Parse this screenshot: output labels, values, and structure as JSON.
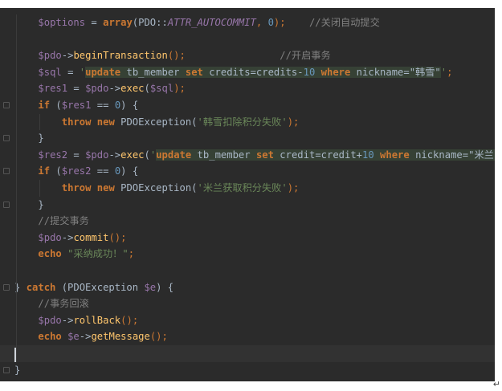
{
  "editor": {
    "lines": [
      [
        {
          "t": "$options",
          "c": "var"
        },
        {
          "t": " = ",
          "c": "cls"
        },
        {
          "t": "array",
          "c": "kw"
        },
        {
          "t": "(PDO::",
          "c": "cls"
        },
        {
          "t": "ATTR_AUTOCOMMIT",
          "c": "const"
        },
        {
          "t": ", ",
          "c": "punc"
        },
        {
          "t": "0",
          "c": "num"
        },
        {
          "t": ");",
          "c": "punc"
        },
        {
          "t": "    //关闭自动提交",
          "c": "cmt"
        }
      ],
      [],
      [
        {
          "t": "$pdo",
          "c": "var"
        },
        {
          "t": "->",
          "c": "cls"
        },
        {
          "t": "beginTransaction",
          "c": "fn"
        },
        {
          "t": "();",
          "c": "punc"
        },
        {
          "t": "                //开启事务",
          "c": "cmt"
        }
      ],
      [
        {
          "t": "$sql",
          "c": "var"
        },
        {
          "t": " = ",
          "c": "cls"
        },
        {
          "t": "'",
          "c": "str"
        },
        {
          "t": "update",
          "c": "sqlk"
        },
        {
          "t": " tb_member ",
          "c": "sql"
        },
        {
          "t": "set",
          "c": "sqlk"
        },
        {
          "t": " credits=credits-",
          "c": "sql"
        },
        {
          "t": "10",
          "c": "sqln"
        },
        {
          "t": " ",
          "c": "sql"
        },
        {
          "t": "where",
          "c": "sqlk"
        },
        {
          "t": " nickname=\"韩雪\"",
          "c": "sql"
        },
        {
          "t": "'",
          "c": "str"
        },
        {
          "t": ";",
          "c": "punc"
        }
      ],
      [
        {
          "t": "$res1",
          "c": "var"
        },
        {
          "t": " = ",
          "c": "cls"
        },
        {
          "t": "$pdo",
          "c": "var"
        },
        {
          "t": "->",
          "c": "cls"
        },
        {
          "t": "exec",
          "c": "fn"
        },
        {
          "t": "(",
          "c": "cls"
        },
        {
          "t": "$sql",
          "c": "var"
        },
        {
          "t": ");",
          "c": "punc"
        }
      ],
      [
        {
          "t": "if",
          "c": "kw"
        },
        {
          "t": " (",
          "c": "cls"
        },
        {
          "t": "$res1",
          "c": "var"
        },
        {
          "t": " == ",
          "c": "cls"
        },
        {
          "t": "0",
          "c": "num"
        },
        {
          "t": ") {",
          "c": "cls"
        }
      ],
      [
        {
          "t": "    ",
          "c": "cls"
        },
        {
          "t": "throw",
          "c": "kw"
        },
        {
          "t": " ",
          "c": "cls"
        },
        {
          "t": "new",
          "c": "kw"
        },
        {
          "t": " PDOException(",
          "c": "cls"
        },
        {
          "t": "'韩雪扣除积分失败'",
          "c": "str"
        },
        {
          "t": ");",
          "c": "punc"
        }
      ],
      [
        {
          "t": "}",
          "c": "cls"
        }
      ],
      [
        {
          "t": "$res2",
          "c": "var"
        },
        {
          "t": " = ",
          "c": "cls"
        },
        {
          "t": "$pdo",
          "c": "var"
        },
        {
          "t": "->",
          "c": "cls"
        },
        {
          "t": "exec",
          "c": "fn"
        },
        {
          "t": "(",
          "c": "cls"
        },
        {
          "t": "'",
          "c": "str"
        },
        {
          "t": "update",
          "c": "sqlk"
        },
        {
          "t": " tb_member ",
          "c": "sql"
        },
        {
          "t": "set",
          "c": "sqlk"
        },
        {
          "t": " credit=credit+",
          "c": "sql"
        },
        {
          "t": "10",
          "c": "sqln"
        },
        {
          "t": " ",
          "c": "sql"
        },
        {
          "t": "where",
          "c": "sqlk"
        },
        {
          "t": " nickname=\"米兰\"",
          "c": "sql"
        },
        {
          "t": "'",
          "c": "str"
        },
        {
          "t": ");",
          "c": "punc"
        }
      ],
      [
        {
          "t": "if",
          "c": "kw"
        },
        {
          "t": " (",
          "c": "cls"
        },
        {
          "t": "$res2",
          "c": "var"
        },
        {
          "t": " == ",
          "c": "cls"
        },
        {
          "t": "0",
          "c": "num"
        },
        {
          "t": ") {",
          "c": "cls"
        }
      ],
      [
        {
          "t": "    ",
          "c": "cls"
        },
        {
          "t": "throw",
          "c": "kw"
        },
        {
          "t": " ",
          "c": "cls"
        },
        {
          "t": "new",
          "c": "kw"
        },
        {
          "t": " PDOException(",
          "c": "cls"
        },
        {
          "t": "'米兰获取积分失败'",
          "c": "str"
        },
        {
          "t": ");",
          "c": "punc"
        }
      ],
      [
        {
          "t": "}",
          "c": "cls"
        }
      ],
      [
        {
          "t": "//提交事务",
          "c": "cmt"
        }
      ],
      [
        {
          "t": "$pdo",
          "c": "var"
        },
        {
          "t": "->",
          "c": "cls"
        },
        {
          "t": "commit",
          "c": "fn"
        },
        {
          "t": "();",
          "c": "punc"
        }
      ],
      [
        {
          "t": "echo",
          "c": "kw"
        },
        {
          "t": " ",
          "c": "cls"
        },
        {
          "t": "\"采纳成功！\"",
          "c": "str"
        },
        {
          "t": ";",
          "c": "punc"
        }
      ],
      [],
      [
        {
          "t": "} ",
          "c": "cls"
        },
        {
          "t": "catch",
          "c": "kw"
        },
        {
          "t": " (PDOException ",
          "c": "cls"
        },
        {
          "t": "$e",
          "c": "var"
        },
        {
          "t": ") {",
          "c": "cls"
        }
      ],
      [
        {
          "t": "//事务回滚",
          "c": "cmt"
        }
      ],
      [
        {
          "t": "$pdo",
          "c": "var"
        },
        {
          "t": "->",
          "c": "cls"
        },
        {
          "t": "rollBack",
          "c": "fn"
        },
        {
          "t": "();",
          "c": "punc"
        }
      ],
      [
        {
          "t": "echo",
          "c": "kw"
        },
        {
          "t": " ",
          "c": "cls"
        },
        {
          "t": "$e",
          "c": "var"
        },
        {
          "t": "->",
          "c": "cls"
        },
        {
          "t": "getMessage",
          "c": "fn"
        },
        {
          "t": "();",
          "c": "punc"
        }
      ],
      [],
      [
        {
          "t": "}",
          "c": "cls"
        }
      ]
    ],
    "indents": [
      2,
      0,
      2,
      2,
      2,
      2,
      2,
      2,
      2,
      2,
      2,
      2,
      2,
      2,
      2,
      0,
      0,
      2,
      2,
      2,
      0,
      0
    ],
    "current_line": 20
  },
  "colors": {
    "background": "#2b2b2b",
    "keyword": "#cc7832",
    "variable": "#9876aa",
    "string": "#6a8759",
    "comment": "#808080",
    "function": "#ffc66d",
    "number": "#6897bb",
    "sql_highlight": "#364135"
  },
  "marks": {
    "pilcrow": "↵"
  }
}
